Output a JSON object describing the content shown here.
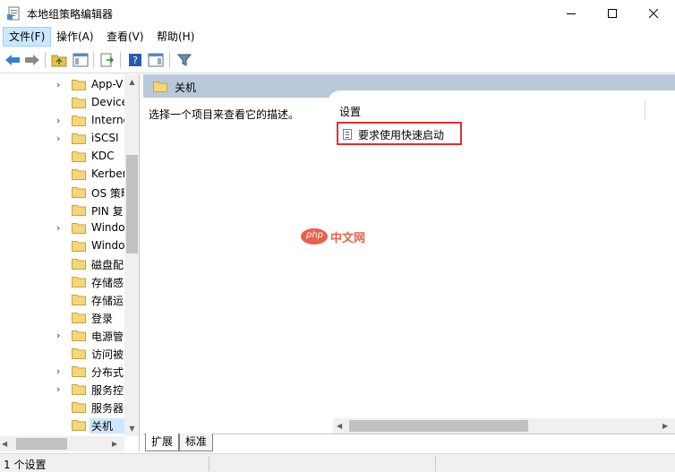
{
  "window": {
    "title": "本地组策略编辑器"
  },
  "menu": [
    "文件(F)",
    "操作(A)",
    "查看(V)",
    "帮助(H)"
  ],
  "tree": {
    "items": [
      {
        "label": "App-V",
        "expandable": true
      },
      {
        "label": "Device",
        "expandable": false
      },
      {
        "label": "Internet",
        "expandable": true
      },
      {
        "label": "iSCSI",
        "expandable": true
      },
      {
        "label": "KDC",
        "expandable": false
      },
      {
        "label": "Kerberos",
        "expandable": false
      },
      {
        "label": "OS 策略",
        "expandable": false
      },
      {
        "label": "PIN 复",
        "expandable": false
      },
      {
        "label": "Windows",
        "expandable": true
      },
      {
        "label": "Windows",
        "expandable": false
      },
      {
        "label": "磁盘配",
        "expandable": false
      },
      {
        "label": "存储感",
        "expandable": false
      },
      {
        "label": "存储运",
        "expandable": false
      },
      {
        "label": "登录",
        "expandable": false
      },
      {
        "label": "电源管",
        "expandable": true
      },
      {
        "label": "访问被",
        "expandable": false
      },
      {
        "label": "分布式",
        "expandable": true
      },
      {
        "label": "服务控",
        "expandable": true
      },
      {
        "label": "服务器",
        "expandable": false
      },
      {
        "label": "关机",
        "expandable": false,
        "selected": true
      }
    ]
  },
  "details": {
    "header_title": "关机",
    "description": "选择一个项目来查看它的描述。",
    "column_header": "设置",
    "rows": [
      {
        "label": "要求使用快速启动"
      }
    ]
  },
  "tabs": [
    "扩展",
    "标准"
  ],
  "status": {
    "text": "1 个设置"
  },
  "watermark": {
    "badge": "php",
    "text": "中文网"
  },
  "colors": {
    "header_band": "#b9c9da",
    "highlight_border": "#e03030",
    "folder": "#f5d77a",
    "selected": "#cce8ff"
  }
}
